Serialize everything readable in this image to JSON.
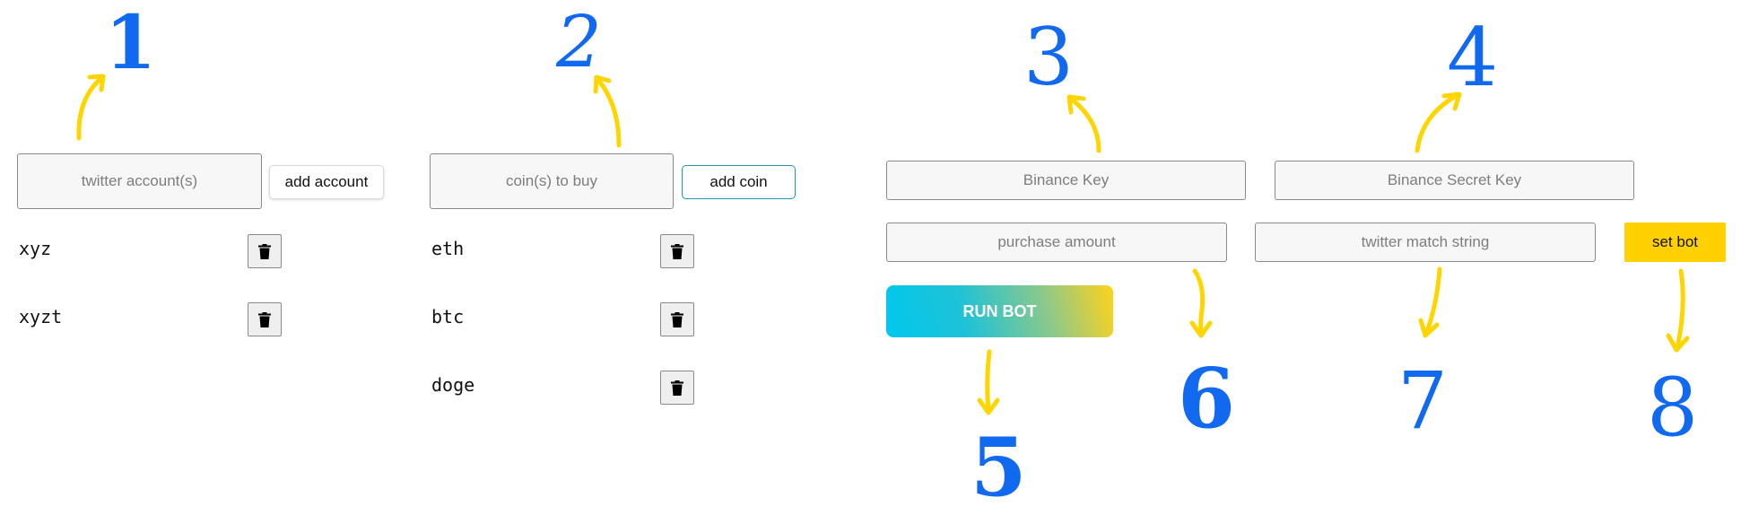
{
  "accounts": {
    "input_placeholder": "twitter account(s)",
    "add_label": "add account",
    "items": [
      "xyz",
      "xyzt"
    ]
  },
  "coins": {
    "input_placeholder": "coin(s) to buy",
    "add_label": "add coin",
    "items": [
      "eth",
      "btc",
      "doge"
    ]
  },
  "bot": {
    "binance_key_placeholder": "Binance Key",
    "binance_secret_placeholder": "Binance Secret Key",
    "purchase_amount_placeholder": "purchase amount",
    "twitter_match_placeholder": "twitter match string",
    "set_bot_label": "set bot",
    "run_bot_label": "RUN BOT"
  },
  "annotations": [
    "1",
    "2",
    "3",
    "4",
    "5",
    "6",
    "7",
    "8"
  ],
  "colors": {
    "annotation_number": "#1169f0",
    "arrow": "#ffd500",
    "coin_button_border": "#1d9aa8",
    "set_bot_bg": "#ffd100",
    "run_gradient_start": "#00c8ee",
    "run_gradient_end": "#ffd31a"
  },
  "icons": {
    "delete": "trash-icon",
    "arrow": "arrow-icon"
  }
}
